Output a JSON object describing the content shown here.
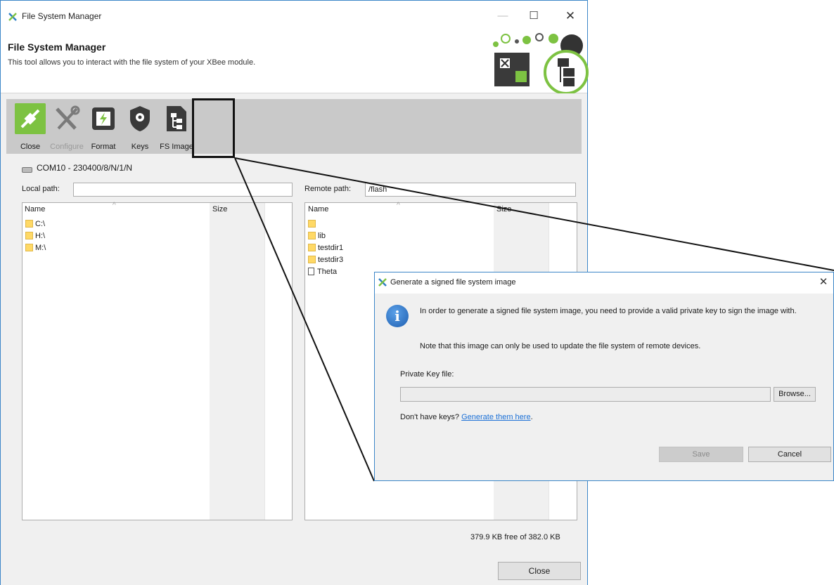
{
  "window": {
    "title": "File System Manager",
    "controls": {
      "minimize": "—",
      "maximize": "☐",
      "close": "✕"
    }
  },
  "header": {
    "title": "File System Manager",
    "description": "This tool allows you to interact with the file system of your XBee module."
  },
  "toolbar": {
    "items": [
      {
        "label": "Close",
        "icon": "plug-icon",
        "enabled": true
      },
      {
        "label": "Configure",
        "icon": "wrench-screwdriver-icon",
        "enabled": false
      },
      {
        "label": "Format",
        "icon": "chip-format-icon",
        "enabled": true
      },
      {
        "label": "Keys",
        "icon": "shield-key-icon",
        "enabled": true
      },
      {
        "label": "FS Image",
        "icon": "file-tree-icon",
        "enabled": true
      }
    ]
  },
  "connection": {
    "port": "COM10 - 230400/8/N/1/N"
  },
  "local": {
    "path_label": "Local path:",
    "path_value": "",
    "columns": [
      "Name",
      "Size"
    ],
    "items": [
      {
        "name": "C:\\",
        "type": "folder"
      },
      {
        "name": "H:\\",
        "type": "folder"
      },
      {
        "name": "M:\\",
        "type": "folder"
      }
    ]
  },
  "remote": {
    "path_label": "Remote path:",
    "path_value": "/flash",
    "columns": [
      "Name",
      "Size"
    ],
    "items": [
      {
        "name": "",
        "type": "folder"
      },
      {
        "name": "lib",
        "type": "folder"
      },
      {
        "name": "testdir1",
        "type": "folder"
      },
      {
        "name": "testdir3",
        "type": "folder"
      },
      {
        "name": "Theta",
        "type": "file"
      }
    ]
  },
  "status": {
    "free_space": "379.9 KB free of 382.0 KB"
  },
  "footer": {
    "close_label": "Close"
  },
  "dialog": {
    "title": "Generate a signed file system image",
    "message": "In order to generate a signed file system image, you need to provide a valid private key to sign the image with.",
    "note": "Note that this image can only be used to update the file system of remote devices.",
    "private_key_label": "Private Key file:",
    "private_key_value": "",
    "browse_label": "Browse...",
    "no_keys_text": "Don't have keys?",
    "generate_link": "Generate them here",
    "save_label": "Save",
    "cancel_label": "Cancel",
    "close": "✕"
  },
  "colors": {
    "accent_green": "#7dc242",
    "window_border": "#3c86c8",
    "link": "#1a6fd6",
    "toolbar_bg": "#c9c9c9"
  }
}
